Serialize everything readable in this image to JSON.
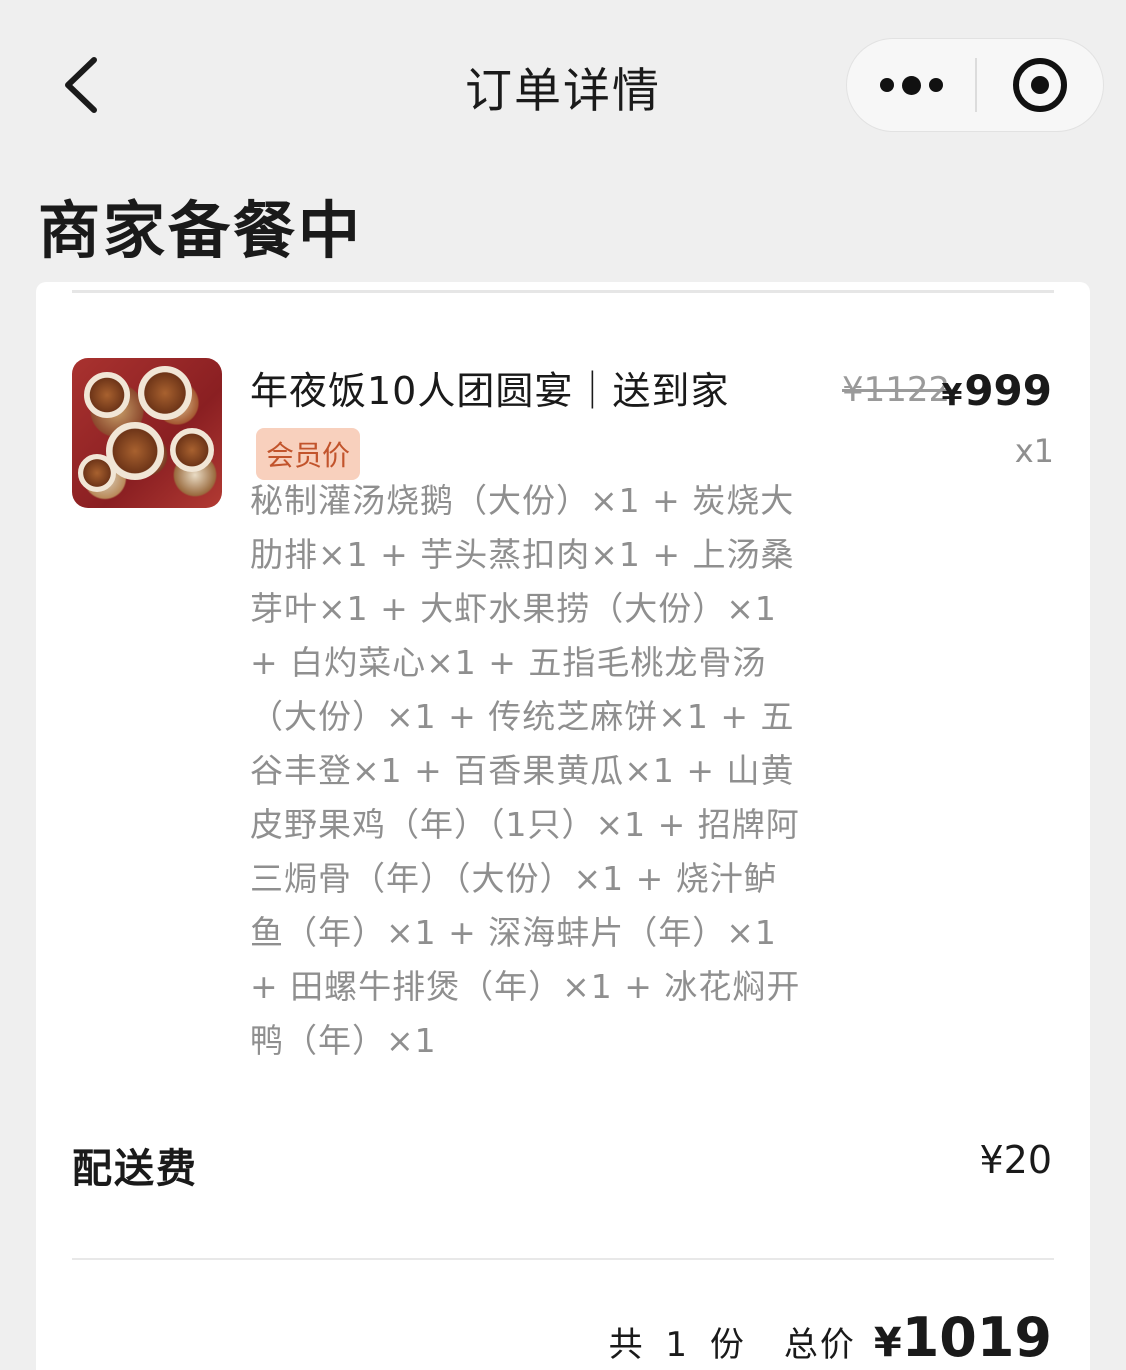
{
  "nav": {
    "title": "订单详情",
    "back_icon": "chevron-left-icon",
    "more_icon": "more-dots-icon",
    "close_icon": "target-close-icon"
  },
  "order": {
    "status": "商家备餐中"
  },
  "item": {
    "name": "年夜饭10人团圆宴｜送到家",
    "badge": "会员价",
    "description": "秘制灌汤烧鹅（大份）×1 + 炭烧大肋排×1 + 芋头蒸扣肉×1 + 上汤桑芽叶×1 + 大虾水果捞（大份）×1 + 白灼菜心×1 + 五指毛桃龙骨汤（大份）×1 + 传统芝麻饼×1 + 五谷丰登×1 + 百香果黄瓜×1 + 山黄皮野果鸡（年）（1只）×1 + 招牌阿三焗骨（年）（大份）×1 + 烧汁鲈鱼（年）×1 + 深海蚌片（年）×1 + 田螺牛排煲（年）×1 + 冰花焖开鸭（年）×1",
    "original_price": "¥1122",
    "price_symbol": "¥",
    "price": "999",
    "quantity": "x1"
  },
  "delivery": {
    "label": "配送费",
    "value": "¥20"
  },
  "summary": {
    "count_text": "共 1 份",
    "total_label": "总价",
    "total_symbol": "¥",
    "total_value": "1019"
  },
  "colors": {
    "background": "#efefef",
    "card": "#ffffff",
    "badge_bg": "#f8d0bd",
    "badge_text": "#c2542c",
    "muted_text": "#8f8f8f"
  }
}
